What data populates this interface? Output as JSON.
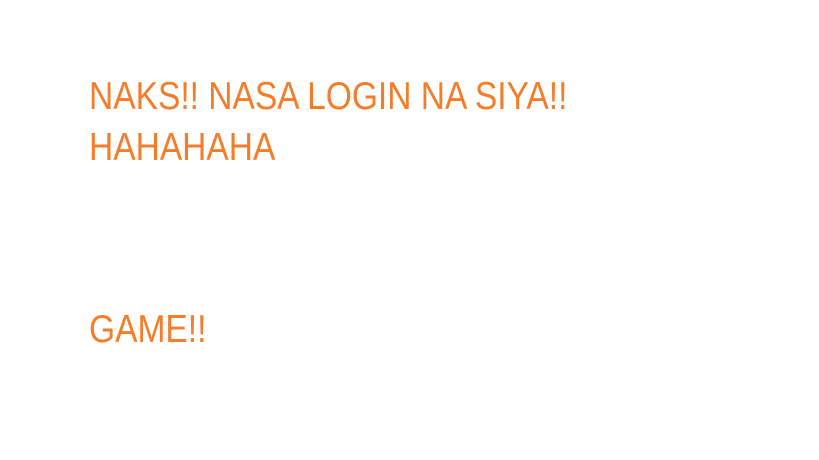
{
  "messages": {
    "line1": "NAKS!! NASA LOGIN NA SIYA!!",
    "line2": "HAHAHAHA",
    "line3": "GAME!!"
  },
  "colors": {
    "text": "#f47d2b",
    "background": "#ffffff"
  }
}
